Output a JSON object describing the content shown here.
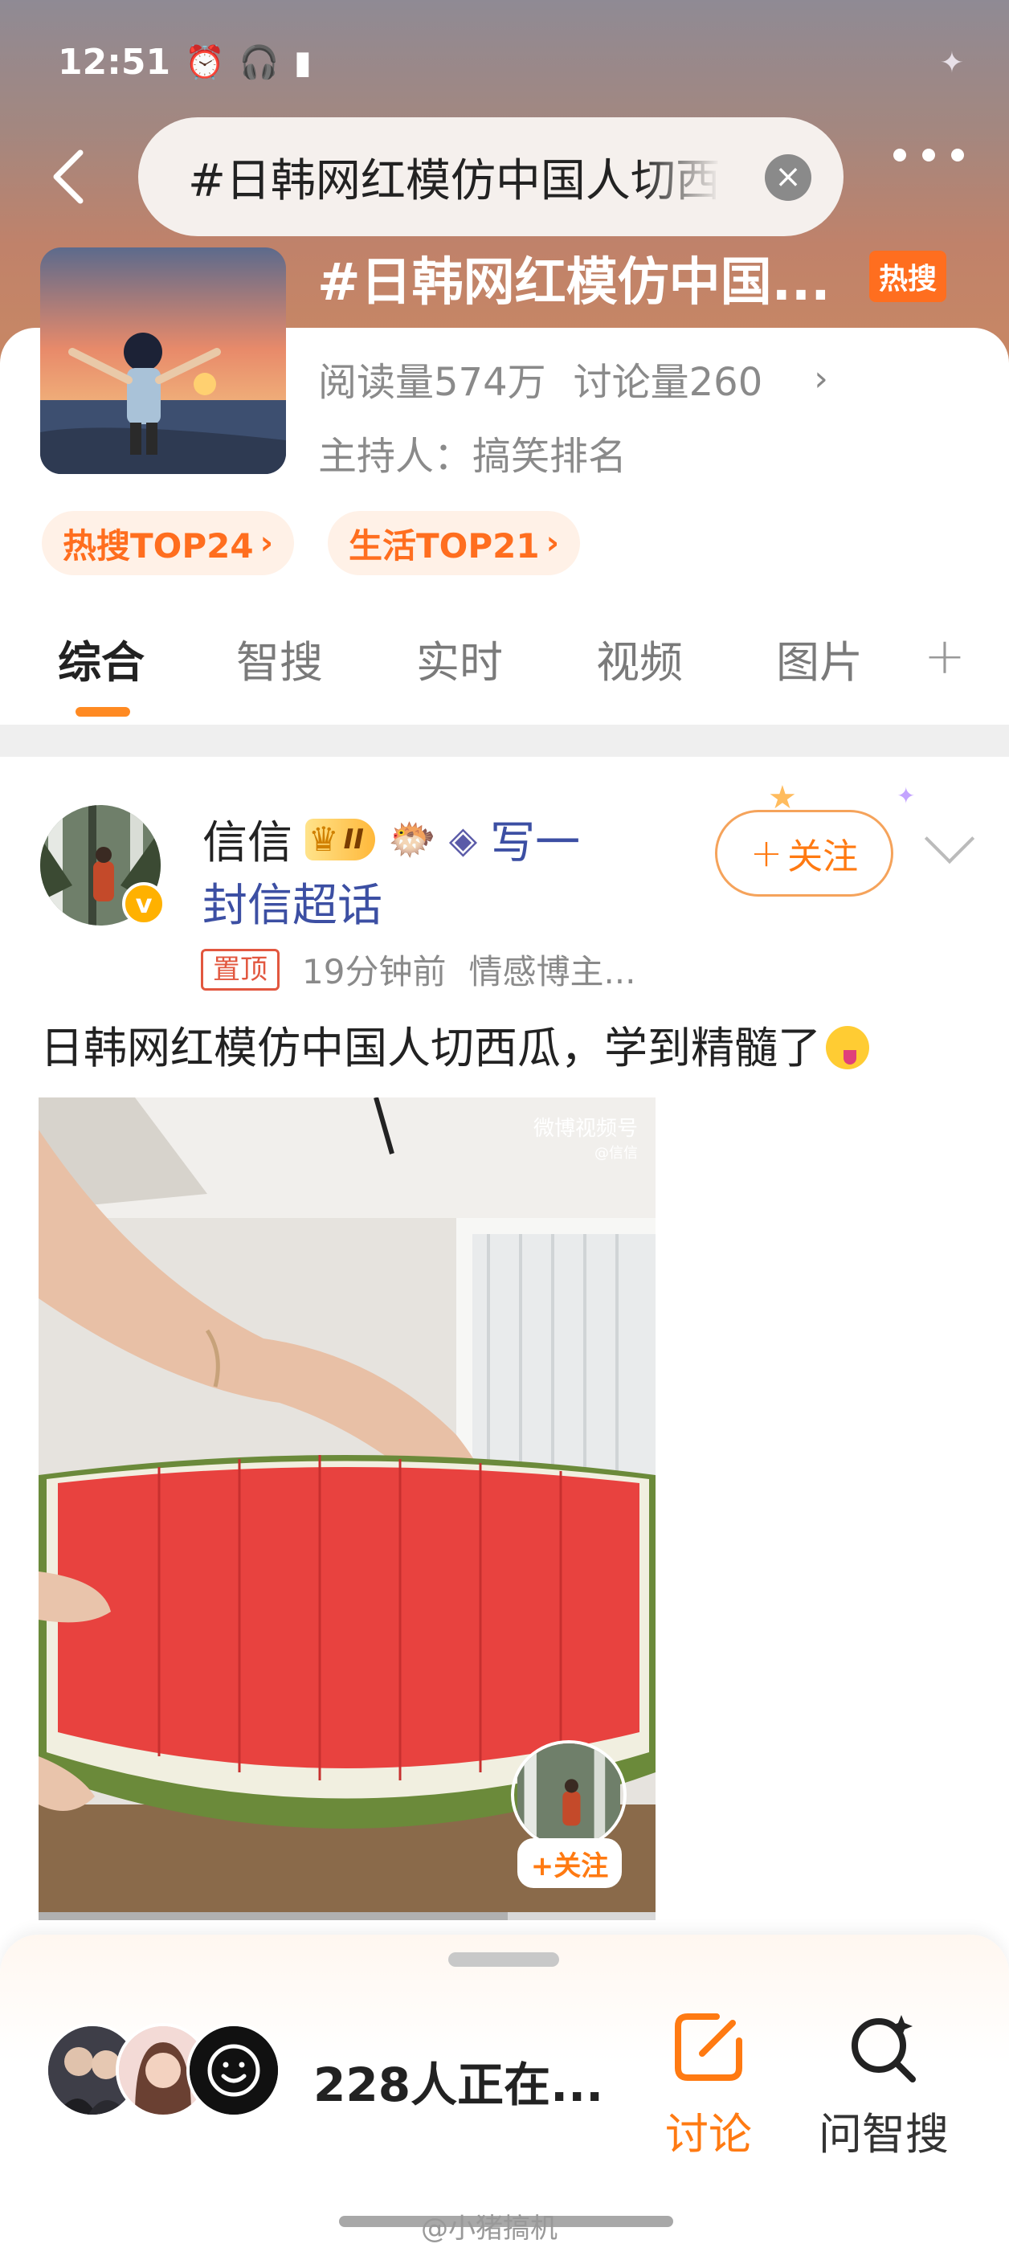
{
  "status": {
    "time": "12:51",
    "alarm_icon": "alarm-icon",
    "headset_icon": "headphones-icon",
    "battery_icon": "battery-icon"
  },
  "search": {
    "query": "#日韩网红模仿中国人切西"
  },
  "topic": {
    "title": "#日韩网红模仿中国...",
    "hot_badge": "热搜",
    "reads": "阅读量574万",
    "discussions": "讨论量260",
    "host": "主持人：搞笑排名",
    "rank_tags": [
      {
        "label": "热搜TOP24"
      },
      {
        "label": "生活TOP21"
      }
    ]
  },
  "tabs": [
    {
      "label": "综合"
    },
    {
      "label": "智搜"
    },
    {
      "label": "实时"
    },
    {
      "label": "视频"
    },
    {
      "label": "图片"
    }
  ],
  "tab_more": "+",
  "post": {
    "author": "信信",
    "vip_level": "II",
    "author_suffix": "写一",
    "author_line2": "封信超话",
    "follow_label": "关注",
    "pin_label": "置顶",
    "time": "19分钟前",
    "category": "情感博主...",
    "text": "日韩网红模仿中国人切西瓜，学到精髓了",
    "video": {
      "watermark": "微博视频号",
      "watermark_sub": "@信信",
      "follow_label": "+关注",
      "progress": 0.76
    }
  },
  "bottom": {
    "online_text": "228人正在...",
    "actions": [
      {
        "label": "讨论",
        "icon": "edit-icon"
      },
      {
        "label": "问智搜",
        "icon": "ai-search-icon"
      }
    ],
    "credit": "@小猪搞机"
  },
  "colors": {
    "accent": "#ff7a12",
    "link": "#3c4fa3",
    "hot": "#ff6e1f"
  }
}
